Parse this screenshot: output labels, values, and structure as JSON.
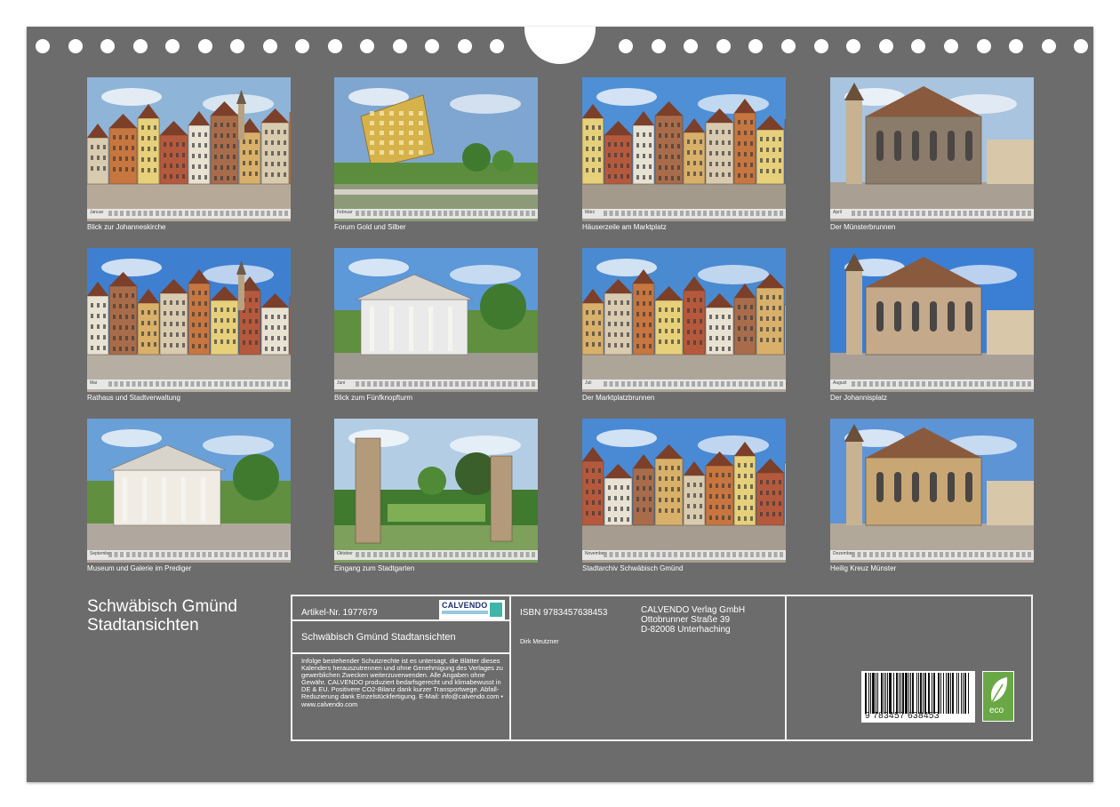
{
  "calendar": {
    "title_line1": "Schwäbisch Gmünd",
    "title_line2": "Stadtansichten"
  },
  "tiles": [
    {
      "caption": "Blick zur Johanneskirche",
      "month": "Januar",
      "sky": "#8eb4d8",
      "ground": "#b7a998",
      "accent": "#c47a4c",
      "scene": "square"
    },
    {
      "caption": "Forum Gold und Silber",
      "month": "Februar",
      "sky": "#7fa6d0",
      "ground": "#8c9a78",
      "accent": "#d6b24a",
      "scene": "modern"
    },
    {
      "caption": "Häuserzeile am Marktplatz",
      "month": "März",
      "sky": "#4f8fd6",
      "ground": "#a39a8c",
      "accent": "#d88a4e",
      "scene": "row"
    },
    {
      "caption": "Der Münsterbrunnen",
      "month": "April",
      "sky": "#a8c4de",
      "ground": "#a99f93",
      "accent": "#8a7b6a",
      "scene": "church"
    },
    {
      "caption": "Rathaus und Stadtverwaltung",
      "month": "Mai",
      "sky": "#3f7fd0",
      "ground": "#b6aea3",
      "accent": "#c98c62",
      "scene": "square"
    },
    {
      "caption": "Blick zum Fünfknopfturm",
      "month": "Juni",
      "sky": "#5d98d8",
      "ground": "#9e9a92",
      "accent": "#eaeaea",
      "scene": "pavilion"
    },
    {
      "caption": "Der Marktplatzbrunnen",
      "month": "Juli",
      "sky": "#4a8ad0",
      "ground": "#aea599",
      "accent": "#e0b055",
      "scene": "row"
    },
    {
      "caption": "Der Johannisplatz",
      "month": "August",
      "sky": "#3b7fd4",
      "ground": "#a8a096",
      "accent": "#c4a98a",
      "scene": "church"
    },
    {
      "caption": "Museum und Galerie im Prediger",
      "month": "September",
      "sky": "#6aa0d8",
      "ground": "#b0a89e",
      "accent": "#f0ece4",
      "scene": "pavilion"
    },
    {
      "caption": "Eingang zum Stadtgarten",
      "month": "Oktober",
      "sky": "#b3cde4",
      "ground": "#7da05a",
      "accent": "#b39a7a",
      "scene": "gate"
    },
    {
      "caption": "Stadtarchiv Schwäbisch Gmünd",
      "month": "November",
      "sky": "#4a8ad4",
      "ground": "#a69d90",
      "accent": "#8a5a3a",
      "scene": "row"
    },
    {
      "caption": "Heilig Kreuz Münster",
      "month": "Dezember",
      "sky": "#5c94d6",
      "ground": "#b2a89a",
      "accent": "#c9a774",
      "scene": "church"
    }
  ],
  "info": {
    "article_no": "Artikel-Nr. 1977679",
    "logo_text": "CALVENDO",
    "subtitle": "Schwäbisch Gmünd Stadtansichten",
    "legal_text": "Infolge bestehender Schutzrechte ist es untersagt, die Blätter dieses Kalenders herauszutrennen und ohne Genehmigung des Verlages zu gewerblichen Zwecken weiterzuverwenden. Alle Angaben ohne Gewähr. CALVENDO produziert bedarfsgerecht und klimabewusst in DE & EU. Positivere CO2-Bilanz dank kurzer Transportwege. Abfall-Reduzierung dank Einzelstückfertigung. E-Mail: info@calvendo.com • www.calvendo.com",
    "isbn": "ISBN 9783457638453",
    "author": "Dirk Meutzner",
    "publisher_line1": "CALVENDO Verlag GmbH",
    "publisher_line2": "Ottobrunner Straße 39",
    "publisher_line3": "D-82008 Unterhaching",
    "barcode_number": "9 783457 638453",
    "eco_label": "eco"
  },
  "colors": {
    "board": "#6c6c6c",
    "text": "#ffffff",
    "eco_green": "#6aa845"
  }
}
